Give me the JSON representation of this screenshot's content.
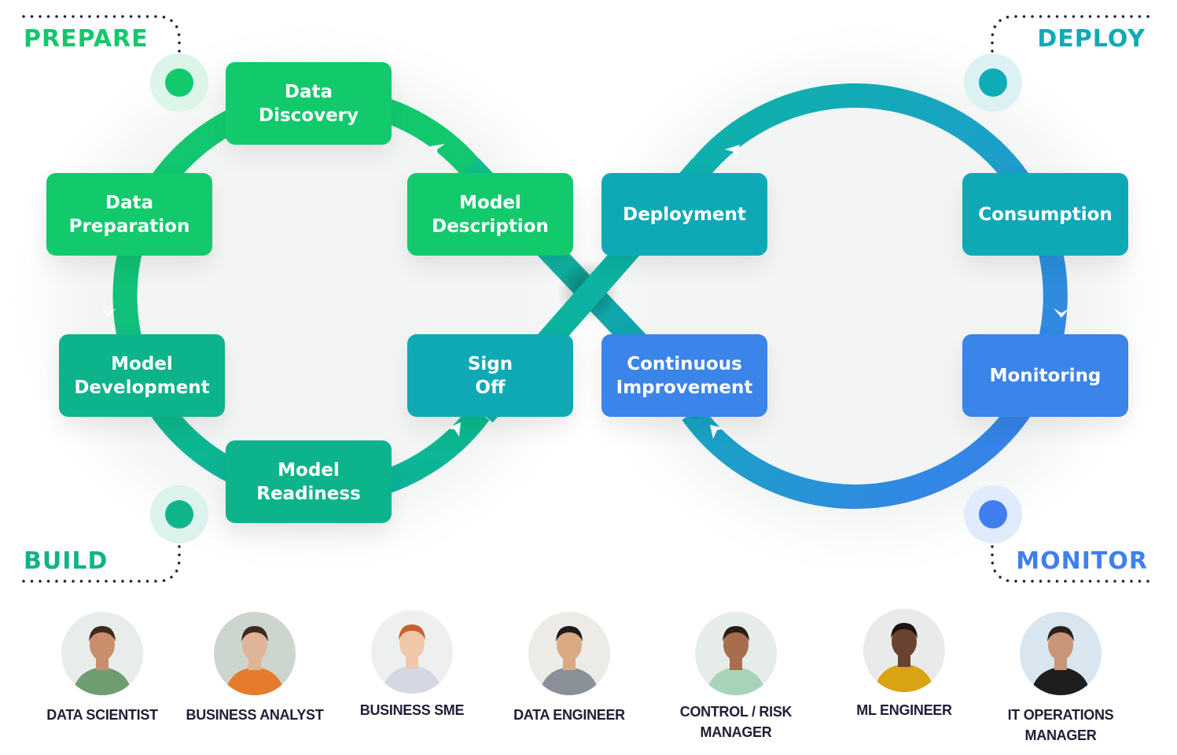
{
  "phases": {
    "prepare": {
      "label": "PREPARE",
      "color": "#14c86a",
      "dot_color": "#12c96c",
      "halo_color": "#dbf5e8"
    },
    "build": {
      "label": "BUILD",
      "color": "#10b387",
      "dot_color": "#0fb488",
      "halo_color": "#dcf2ec"
    },
    "deploy": {
      "label": "DEPLOY",
      "color": "#0eaab6",
      "dot_color": "#0fabb6",
      "halo_color": "#dcf1f3"
    },
    "monitor": {
      "label": "MONITOR",
      "color": "#3f7ff0",
      "dot_color": "#407ef0",
      "halo_color": "#e0ebfc"
    }
  },
  "stages": [
    {
      "id": "data-discovery",
      "lines": [
        "Data",
        "Discovery"
      ],
      "color": "#12c96c"
    },
    {
      "id": "data-preparation",
      "lines": [
        "Data",
        "Preparation"
      ],
      "color": "#12c96c"
    },
    {
      "id": "model-description",
      "lines": [
        "Model",
        "Description"
      ],
      "color": "#12c96c"
    },
    {
      "id": "model-development",
      "lines": [
        "Model",
        "Development"
      ],
      "color": "#0db38b"
    },
    {
      "id": "model-readiness",
      "lines": [
        "Model",
        "Readiness"
      ],
      "color": "#0db38b"
    },
    {
      "id": "sign-off",
      "lines": [
        "Sign",
        "Off"
      ],
      "color": "#0fa9b6"
    },
    {
      "id": "deployment",
      "lines": [
        "Deployment"
      ],
      "color": "#0fa9b6"
    },
    {
      "id": "consumption",
      "lines": [
        "Consumption"
      ],
      "color": "#0fa9b6"
    },
    {
      "id": "continuous-improvement",
      "lines": [
        "Continuous",
        "Improvement"
      ],
      "color": "#3a84ea"
    },
    {
      "id": "monitoring",
      "lines": [
        "Monitoring"
      ],
      "color": "#3a84ea"
    }
  ],
  "loop_colors": {
    "green": "#12c96c",
    "teal": "#0cb39b",
    "cyan": "#0cb0ae",
    "blue": "#4079f4",
    "dots": "#1e1e36"
  },
  "personas": [
    {
      "title": "DATA SCIENTIST",
      "lines": [
        "DATA SCIENTIST"
      ],
      "bg": "#e8ecea",
      "skin": "#c98f6c",
      "hair": "#3b2a20",
      "shirt": "#6f9d72"
    },
    {
      "title": "BUSINESS ANALYST",
      "lines": [
        "BUSINESS ANALYST"
      ],
      "bg": "#cdd5cf",
      "skin": "#e0b496",
      "hair": "#3a2a22",
      "shirt": "#e57b2b"
    },
    {
      "title": "BUSINESS SME",
      "lines": [
        "BUSINESS SME"
      ],
      "bg": "#eef0ef",
      "skin": "#efc7a9",
      "hair": "#c8622b",
      "shirt": "#d5d8e4"
    },
    {
      "title": "DATA ENGINEER",
      "lines": [
        "DATA ENGINEER"
      ],
      "bg": "#ecebe7",
      "skin": "#d8a983",
      "hair": "#1f1b1a",
      "shirt": "#8a9097"
    },
    {
      "title": "CONTROL / RISK MANAGER",
      "lines": [
        "CONTROL / RISK",
        "MANAGER"
      ],
      "bg": "#e6ece9",
      "skin": "#a86d4c",
      "hair": "#2a1d17",
      "shirt": "#a8d3b9"
    },
    {
      "title": "ML ENGINEER",
      "lines": [
        "ML ENGINEER"
      ],
      "bg": "#e9ebea",
      "skin": "#6a4330",
      "hair": "#1c1411",
      "shirt": "#d9a313"
    },
    {
      "title": "IT OPERATIONS MANAGER",
      "lines": [
        "IT OPERATIONS",
        "MANAGER"
      ],
      "bg": "#d9e6f0",
      "skin": "#c89576",
      "hair": "#27221f",
      "shirt": "#1e1e1e"
    }
  ]
}
